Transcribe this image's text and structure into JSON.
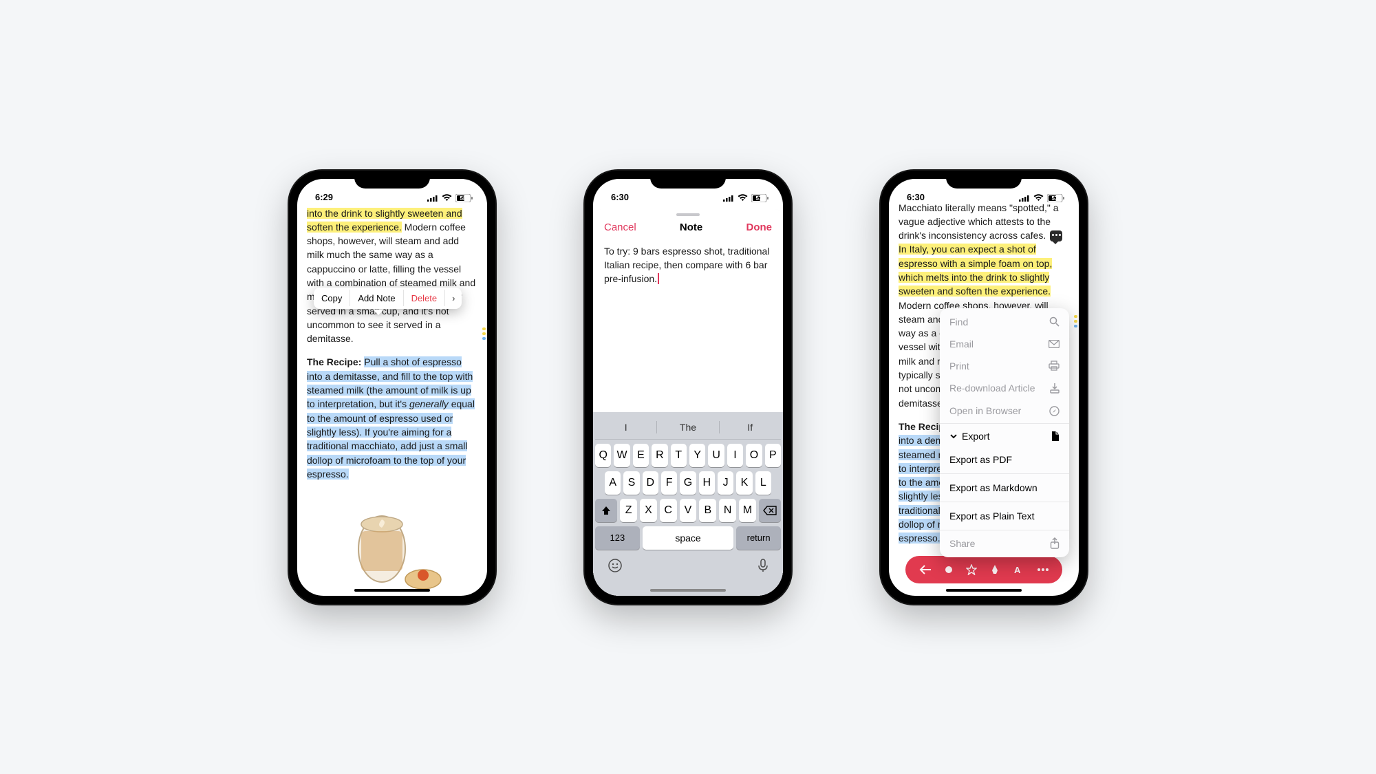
{
  "phone1": {
    "status_time": "6:29",
    "battery": "58",
    "text_hl1": "into the drink to slightly sweeten and soften the experience.",
    "text_plain1": " Modern coffee shops, however, will steam and add milk much the same way as a cappuccino or latte, filling the vessel with a combination of steamed milk and microfoam . Macchiatos are typically served in a small cup, and it's not uncommon to see it served in a demitasse.",
    "recipe_label": "The Recipe: ",
    "recipe_hl_a": "Pull a shot of espresso into a demitasse, and fill to the top with steamed milk (the amount of milk is up to interpretation, but it's ",
    "recipe_italic": "generally",
    "recipe_hl_b": " equal to the amount of espresso used or slightly less). If you're aiming for a traditional macchiato, add just a small dollop of microfoam to the top of your espresso.",
    "context": {
      "copy": "Copy",
      "add_note": "Add Note",
      "delete": "Delete"
    }
  },
  "phone2": {
    "status_time": "6:30",
    "battery": "57",
    "cancel": "Cancel",
    "title": "Note",
    "done": "Done",
    "note_text": "To try: 9 bars espresso shot, traditional Italian recipe, then compare with 6 bar pre-infusion.",
    "suggestions": [
      "I",
      "The",
      "If"
    ],
    "keys_row1": [
      "Q",
      "W",
      "E",
      "R",
      "T",
      "Y",
      "U",
      "I",
      "O",
      "P"
    ],
    "keys_row2": [
      "A",
      "S",
      "D",
      "F",
      "G",
      "H",
      "J",
      "K",
      "L"
    ],
    "keys_row3": [
      "Z",
      "X",
      "C",
      "V",
      "B",
      "N",
      "M"
    ],
    "num_key": "123",
    "space_label": "space",
    "return_label": "return"
  },
  "phone3": {
    "status_time": "6:30",
    "battery": "57",
    "lead": "Macchiato literally means \"spotted,\" a vague adjective which attests to the drink's inconsistency across cafes. ",
    "hl_yellow": "In Italy, you can expect a shot of espresso with a simple foam on top, which melts into the drink to slightly sweeten and soften the experience.",
    "plain": " Modern coffee shops, however, will steam and add milk much the same way as a cappuccino or latte, filling the vessel with a combination of steamed milk and microfoam . Macchiatos are typically served in a small cup, and it's not uncommon to see it served in a demitasse.",
    "recipe_label": "The Recipe: ",
    "recipe_hl_a": "Pull a shot of espresso into a demitasse, and fill to the top with steamed milk (the amount of milk is up to interpretation, but it's ",
    "recipe_italic": "generally",
    "recipe_hl_b": " equal to the amount of espresso used or slightly less). If you're aiming for a traditional macchiato, add just a small dollop of microfoam to the top of your espresso.",
    "menu": {
      "find": "Find",
      "email": "Email",
      "print": "Print",
      "redownload": "Re-download Article",
      "open_browser": "Open in Browser",
      "export": "Export",
      "export_pdf": "Export as PDF",
      "export_md": "Export as Markdown",
      "export_txt": "Export as Plain Text",
      "share": "Share"
    }
  }
}
